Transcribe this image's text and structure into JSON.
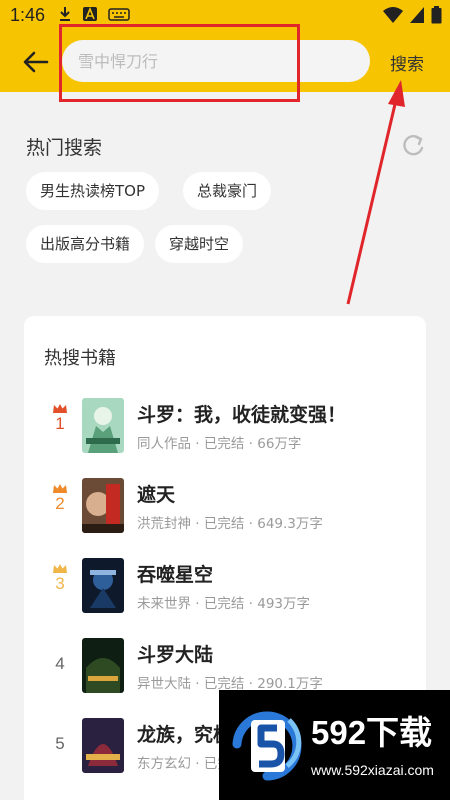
{
  "status": {
    "time": "1:46"
  },
  "search": {
    "placeholder": "雪中悍刀行",
    "button": "搜索"
  },
  "hot_search": {
    "title": "热门搜索",
    "tags": [
      "男生热读榜TOP",
      "总裁豪门",
      "出版高分书籍",
      "穿越时空"
    ]
  },
  "hot_books": {
    "title": "热搜书籍",
    "items": [
      {
        "rank": "1",
        "title": "斗罗：我，收徒就变强！",
        "meta": "同人作品 · 已完结 · 66万字"
      },
      {
        "rank": "2",
        "title": "遮天",
        "meta": "洪荒封神 · 已完结 · 649.3万字"
      },
      {
        "rank": "3",
        "title": "吞噬星空",
        "meta": "未来世界 · 已完结 · 493万字"
      },
      {
        "rank": "4",
        "title": "斗罗大陆",
        "meta": "异世大陆 · 已完结 · 290.1万字"
      },
      {
        "rank": "5",
        "title": "龙族，究极",
        "meta": "东方玄幻 · 已完结"
      }
    ]
  },
  "colors": {
    "header": "#f6c400",
    "rank1": "#e2502a",
    "rank2": "#ef8a2c",
    "rank3": "#f0b64a",
    "highlight": "#e0262a"
  },
  "watermark": {
    "brand": "592下载",
    "url": "www.592xiazai.com"
  }
}
